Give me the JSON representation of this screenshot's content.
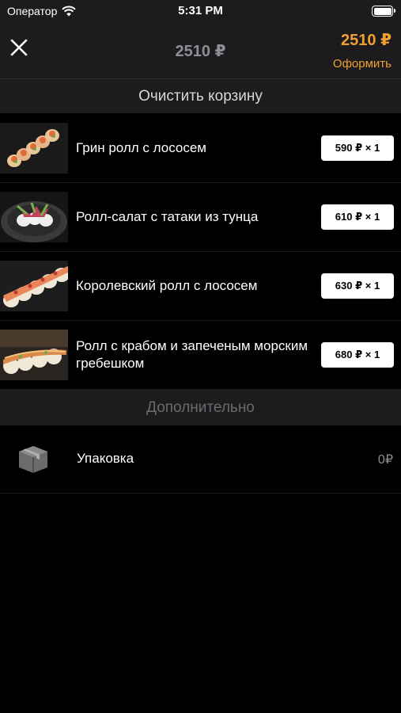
{
  "status_bar": {
    "carrier": "Оператор",
    "time": "5:31 PM"
  },
  "nav": {
    "title": "2510 ₽",
    "total": "2510 ₽",
    "checkout_label": "Оформить"
  },
  "clear_cart_label": "Очистить корзину",
  "items": [
    {
      "name": "Грин ролл с лососем",
      "qty": "590 ₽ × 1"
    },
    {
      "name": "Ролл-салат с татаки из тунца",
      "qty": "610 ₽ × 1"
    },
    {
      "name": "Королевский ролл с лососем",
      "qty": "630 ₽ × 1"
    },
    {
      "name": "Ролл с крабом и запеченым морским гребешком",
      "qty": "680 ₽ × 1"
    }
  ],
  "extra_header": "Дополнительно",
  "packaging": {
    "label": "Упаковка",
    "price": "0₽",
    "icon": "box-icon"
  },
  "colors": {
    "accent": "#f0a030",
    "bar_bg": "#1c1c1e",
    "background": "#000000"
  }
}
